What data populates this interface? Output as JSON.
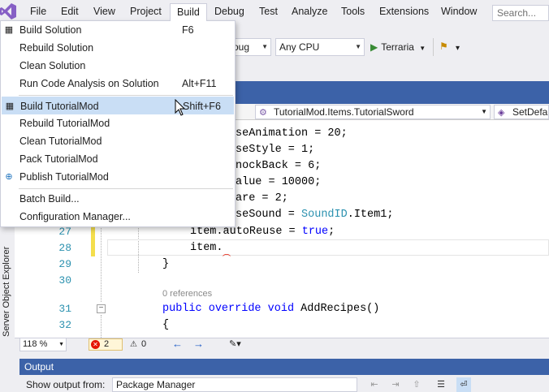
{
  "menubar": {
    "items": [
      "File",
      "Edit",
      "View",
      "Project",
      "Build",
      "Debug",
      "Test",
      "Analyze",
      "Tools",
      "Extensions",
      "Window"
    ],
    "active": "Build",
    "search_placeholder": "Search..."
  },
  "toolbar": {
    "config_partial": "oug",
    "platform": "Any CPU",
    "run_target": "Terraria"
  },
  "build_menu": {
    "items": [
      {
        "label": "Build Solution",
        "shortcut": "F6"
      },
      {
        "label": "Rebuild Solution",
        "shortcut": ""
      },
      {
        "label": "Clean Solution",
        "shortcut": ""
      },
      {
        "label": "Run Code Analysis on Solution",
        "shortcut": "Alt+F11"
      },
      {
        "label": "Build TutorialMod",
        "shortcut": "Shift+F6"
      },
      {
        "label": "Rebuild TutorialMod",
        "shortcut": ""
      },
      {
        "label": "Clean TutorialMod",
        "shortcut": ""
      },
      {
        "label": "Pack TutorialMod",
        "shortcut": ""
      },
      {
        "label": "Publish TutorialMod",
        "shortcut": ""
      },
      {
        "label": "Batch Build...",
        "shortcut": ""
      },
      {
        "label": "Configuration Manager...",
        "shortcut": ""
      }
    ],
    "highlighted": "Build TutorialMod"
  },
  "editor": {
    "nav_type": "TutorialMod.Items.TutorialSword",
    "nav_member": "SetDefau",
    "hidden_code": [
      "seAnimation = 20;",
      "seStyle = 1;",
      "nockBack = 6;",
      "alue = 10000;",
      "are = 2;",
      "seSound = ",
      "SoundID",
      ".Item1;"
    ],
    "line_numbers": [
      "27",
      "28",
      "29",
      "30",
      "31",
      "32"
    ],
    "line27": {
      "pre": "item.autoReuse = ",
      "kw": "true",
      "post": ";"
    },
    "line28": "item.",
    "line29": "}",
    "references": "0 references",
    "line31": {
      "kw1": "public",
      "kw2": "override",
      "kw3": "void",
      "name": "AddRecipes()"
    },
    "line32": "{"
  },
  "status": {
    "zoom": "118 %",
    "errors": "2",
    "warnings": "0"
  },
  "side_tab": "Server Object Explorer",
  "output": {
    "title": "Output",
    "show_from_label": "Show output from:",
    "source": "Package Manager"
  }
}
